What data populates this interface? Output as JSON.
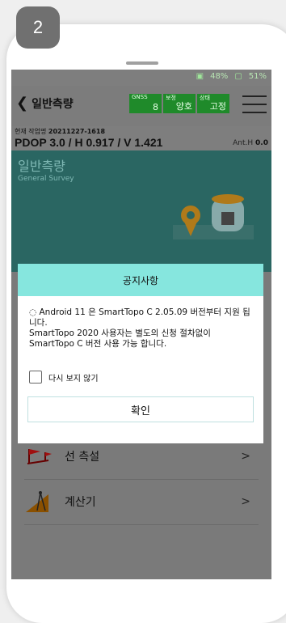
{
  "step_number": "2",
  "status_bar": {
    "battery_a": "48%",
    "battery_b": "51%"
  },
  "header": {
    "back_label": "일반측량",
    "gnss": [
      {
        "label": "GNSS",
        "value": "8"
      },
      {
        "label": "보정",
        "value": "양호"
      },
      {
        "label": "상태",
        "value": "고정"
      }
    ]
  },
  "info": {
    "job_label": "현재 작업명",
    "job_value": "20211227-1618",
    "pdop": "PDOP 3.0 / H 0.917 / V 1.421",
    "anth_label": "Ant.H",
    "anth_value": "0.0"
  },
  "banner": {
    "title": "일반측량",
    "subtitle": "General Survey"
  },
  "list": [
    {
      "label": "선 측설",
      "arrow": ">"
    },
    {
      "label": "계산기",
      "arrow": ">"
    }
  ],
  "dialog": {
    "title": "공지사항",
    "line1": "◌ Android 11 은 SmartTopo C 2.05.09 버전부터 지원 됩니다.",
    "line2": "SmartTopo 2020 사용자는 별도의 신청 절차없이 SmartTopo C 버전 사용 가능 합니다.",
    "checkbox_label": "다시 보지 않기",
    "ok_label": "확인"
  }
}
